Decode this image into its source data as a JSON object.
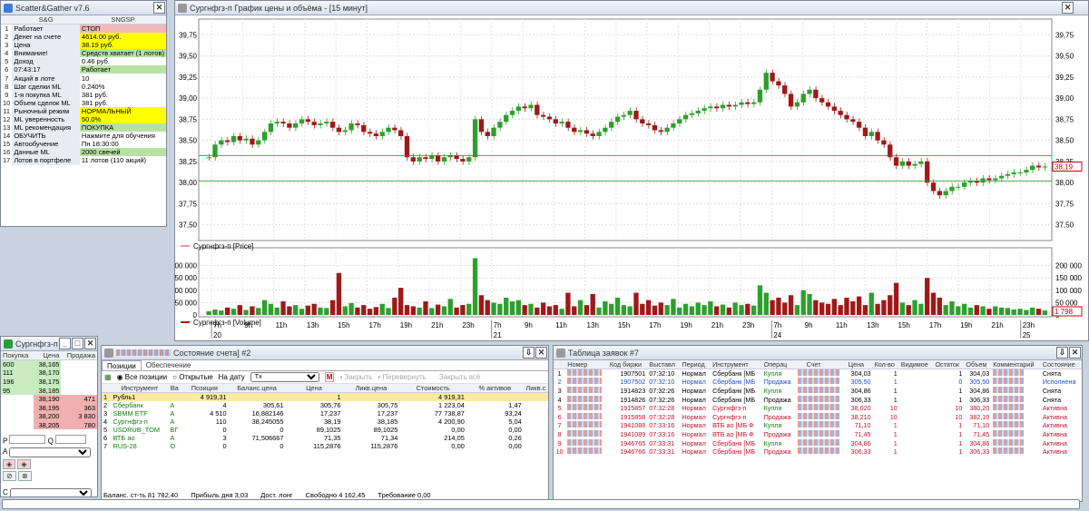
{
  "sg": {
    "title": "Scatter&Gather v7.6",
    "col1": "S&G",
    "col2": "SNGSP",
    "rows": [
      [
        "1",
        "Работает",
        "СТОП",
        "pk"
      ],
      [
        "2",
        "Денег на счете",
        "4614.00 руб.",
        "y"
      ],
      [
        "3",
        "Цена",
        "38.19 руб.",
        "y"
      ],
      [
        "4",
        "Внимание!",
        "Средств хватает (1 лотов)",
        "g"
      ],
      [
        "5",
        "Доход",
        "0.46 руб.",
        ""
      ],
      [
        "6",
        "07:43:17",
        "Работает",
        "g"
      ],
      [
        "7",
        "Акций в лоте",
        "10",
        ""
      ],
      [
        "8",
        "Шаг сделки ML",
        "0.240%",
        ""
      ],
      [
        "9",
        "1-я покупка ML",
        "381 руб.",
        ""
      ],
      [
        "10",
        "Объем сделок ML",
        "381 руб.",
        ""
      ],
      [
        "11",
        "Рыночный режим",
        "НОРМАЛЬНЫЙ",
        "y"
      ],
      [
        "12",
        "ML уверенность",
        "50.0%",
        "y"
      ],
      [
        "13",
        "ML рекомендация",
        "ПОКУПКА",
        "g"
      ],
      [
        "14",
        "ОБУЧИТЬ",
        "Нажмите для обучения",
        ""
      ],
      [
        "15",
        "Автообучение",
        "Пн 18:30:00",
        ""
      ],
      [
        "16",
        "Данные ML",
        "2000 свечей",
        "g"
      ],
      [
        "17",
        "Лотов в портфеле",
        "11 лотов (110 акций)",
        ""
      ]
    ]
  },
  "chart": {
    "title": "Сургнфгз-п График цены и объёма - [15 минут]",
    "price_legend": "Сургнфгз-п [Price]",
    "volume_legend": "Сургнфгз-п [Volume]",
    "price_tag": "38,19",
    "volume_tag": "1 798",
    "price_ticks": [
      "39,75",
      "39,50",
      "39,25",
      "39,00",
      "38,75",
      "38,50",
      "38,25",
      "38,00",
      "37,75",
      "37,50"
    ],
    "volume_ticks": [
      "200 000",
      "150 000",
      "100 000",
      "50 000",
      "0"
    ],
    "time_labels": [
      "7h",
      "9h",
      "11h",
      "13h",
      "15h",
      "17h",
      "19h",
      "21h",
      "23h",
      "7h",
      "9h",
      "11h",
      "13h",
      "15h",
      "17h",
      "19h",
      "21h",
      "23h",
      "7h",
      "9h",
      "11h",
      "13h",
      "15h",
      "17h",
      "19h",
      "21h",
      "23h"
    ],
    "date_labels": [
      "20",
      "21",
      "24",
      "25"
    ]
  },
  "chart_data": {
    "type": "candlestick",
    "title": "Сургнфгз-п График цены и объёма - [15 минут]",
    "ylim": [
      37.4,
      39.85
    ],
    "volume_ylim": [
      0,
      250000
    ],
    "grid": true,
    "close": [
      38.3,
      38.45,
      38.5,
      38.48,
      38.55,
      38.5,
      38.52,
      38.45,
      38.5,
      38.6,
      38.7,
      38.72,
      38.7,
      38.65,
      38.7,
      38.75,
      38.72,
      38.68,
      38.7,
      38.72,
      38.65,
      38.6,
      38.62,
      38.7,
      38.68,
      38.6,
      38.58,
      38.55,
      38.6,
      38.65,
      38.62,
      38.55,
      38.3,
      38.25,
      38.3,
      38.28,
      38.32,
      38.25,
      38.3,
      38.32,
      38.28,
      38.25,
      38.3,
      38.75,
      38.6,
      38.55,
      38.65,
      38.72,
      38.8,
      38.85,
      38.9,
      38.88,
      38.92,
      38.8,
      38.78,
      38.75,
      38.7,
      38.72,
      38.65,
      38.6,
      38.62,
      38.58,
      38.55,
      38.6,
      38.65,
      38.72,
      38.78,
      38.8,
      38.85,
      38.75,
      38.7,
      38.68,
      38.62,
      38.6,
      38.65,
      38.7,
      38.75,
      38.8,
      38.82,
      38.85,
      38.88,
      38.9,
      38.88,
      38.92,
      38.9,
      38.92,
      38.95,
      38.93,
      38.95,
      39.1,
      39.3,
      39.2,
      39.15,
      39.05,
      38.9,
      38.95,
      39.05,
      39.1,
      39.0,
      38.95,
      38.9,
      38.85,
      38.8,
      38.75,
      38.72,
      38.65,
      38.55,
      38.6,
      38.5,
      38.45,
      38.3,
      38.2,
      38.25,
      38.2,
      38.22,
      38.25,
      38.0,
      37.9,
      37.85,
      37.9,
      37.95,
      37.95,
      38.0,
      38.02,
      38.0,
      38.05,
      38.03,
      38.05,
      38.08,
      38.1,
      38.12,
      38.12,
      38.15,
      38.2,
      38.18,
      38.19
    ],
    "volume": [
      15000,
      22000,
      18000,
      30000,
      25000,
      40000,
      20000,
      35000,
      28000,
      60000,
      45000,
      30000,
      55000,
      35000,
      40000,
      25000,
      38000,
      45000,
      30000,
      28000,
      60000,
      170000,
      35000,
      48000,
      30000,
      40000,
      25000,
      32000,
      45000,
      28000,
      70000,
      110000,
      40000,
      35000,
      30000,
      55000,
      28000,
      42000,
      35000,
      65000,
      30000,
      40000,
      45000,
      230000,
      80000,
      60000,
      50000,
      45000,
      70000,
      55000,
      60000,
      40000,
      45000,
      30000,
      50000,
      35000,
      40000,
      25000,
      90000,
      35000,
      60000,
      40000,
      85000,
      30000,
      55000,
      45000,
      70000,
      40000,
      35000,
      90000,
      45000,
      60000,
      38000,
      50000,
      40000,
      65000,
      30000,
      45000,
      35000,
      50000,
      40000,
      55000,
      35000,
      42000,
      30000,
      50000,
      40000,
      45000,
      38000,
      120000,
      90000,
      60000,
      70000,
      50000,
      80000,
      40000,
      100000,
      85000,
      60000,
      50000,
      45000,
      65000,
      40000,
      70000,
      55000,
      75000,
      40000,
      90000,
      45000,
      60000,
      80000,
      130000,
      50000,
      40000,
      60000,
      45000,
      150000,
      90000,
      70000,
      40000,
      55000,
      35000,
      45000,
      30000,
      40000,
      35000,
      25000,
      35000,
      30000,
      28000,
      22000,
      25000,
      20000,
      30000,
      25000,
      18000
    ]
  },
  "orderbook": {
    "title": "Сургнфгз-п [МБ",
    "headers": [
      "Покупка",
      "Цена",
      "Продажа"
    ],
    "rows": [
      [
        "600",
        "38,165",
        ""
      ],
      [
        "111",
        "38,170",
        ""
      ],
      [
        "196",
        "38,175",
        ""
      ],
      [
        "95",
        "38,185",
        ""
      ],
      [
        "",
        "38,190",
        "471"
      ],
      [
        "",
        "38,195",
        "363"
      ],
      [
        "",
        "38,200",
        "3 830"
      ],
      [
        "",
        "38,205",
        "780"
      ]
    ]
  },
  "state": {
    "title": "Состояние счета] #2",
    "tabs": [
      "Позиции",
      "Обеспечение"
    ],
    "all": "Все позиции",
    "open": "Открытые",
    "ondate": "На дату",
    "tx": "Tx",
    "close": "Закрыть",
    "flip": "Перевернуть",
    "closeall": "Закрыть всё",
    "headers": [
      "",
      "Инструмент",
      "Ва",
      "Позиция",
      "Баланс.цена",
      "Цена",
      "Ликв.цена",
      "Стоимость",
      "% активов",
      "Ликв.с"
    ],
    "rows": [
      [
        "1",
        "Рубль1",
        "",
        "4 919,31",
        "",
        "1",
        "",
        "4 919,31",
        "",
        ""
      ],
      [
        "2",
        "Сбербанк",
        "А",
        "4",
        "305,61",
        "305,76",
        "305,75",
        "1 223,04",
        "1,47",
        ""
      ],
      [
        "3",
        "SBMM ETF",
        "А",
        "4 510",
        "16,882146",
        "17,237",
        "17,237",
        "77 738,87",
        "93,24",
        ""
      ],
      [
        "4",
        "Сургнфгз-п",
        "А",
        "110",
        "38,245055",
        "38,19",
        "38,185",
        "4 200,90",
        "5,04",
        ""
      ],
      [
        "5",
        "USDRUB_TOM",
        "ВГ",
        "0",
        "0",
        "89,1025",
        "89,1025",
        "0,00",
        "0,00",
        ""
      ],
      [
        "6",
        "ВТБ ао",
        "А",
        "3",
        "71,506667",
        "71,35",
        "71,34",
        "214,05",
        "0,26",
        ""
      ],
      [
        "7",
        "RUS-28",
        "О",
        "0",
        "0",
        "115,2876",
        "115,2876",
        "0,00",
        "0,00",
        ""
      ]
    ],
    "footer": {
      "balance": "Баланс. ст-ть  81 782,40",
      "profit": "Прибыль дня   3,03",
      "long": "Дост. лонг",
      "free": "Свободно   4 162,45",
      "req": "Требование   0,00"
    }
  },
  "orders": {
    "title": "Таблица заявок #7",
    "headers": [
      "",
      "Номер",
      "Код биржи",
      "Выставл",
      "Период",
      "Инструмент",
      "Операц",
      "",
      "Счет",
      "Цена",
      "Кол-во",
      "Видимое",
      "Остаток",
      "Объем",
      "Комментарий",
      "Состояние"
    ],
    "rows": [
      [
        "1",
        "1907501",
        "07:32:10",
        "Нормал",
        "Сбербанк [МБ",
        "Купля",
        "304,03",
        "1",
        "1",
        "304,03",
        "Снята",
        "blk"
      ],
      [
        "2",
        "1907502",
        "07:32:10",
        "Нормал",
        "Сбербанк [МБ",
        "Продажа",
        "305,50",
        "1",
        "0",
        "305,50",
        "Исполнена",
        "blu"
      ],
      [
        "3",
        "1914823",
        "07:32:26",
        "Нормал",
        "Сбербанк [МБ",
        "Купля",
        "304,86",
        "1",
        "1",
        "304,86",
        "Снята",
        "blk"
      ],
      [
        "4",
        "1914826",
        "07:32:26",
        "Нормал",
        "Сбербанк [МБ",
        "Продажа",
        "306,33",
        "1",
        "1",
        "306,33",
        "Снята",
        "blk"
      ],
      [
        "5",
        "1915857",
        "07:32:28",
        "Нормал",
        "Сургнфгз-п",
        "Купля",
        "38,020",
        "10",
        "10",
        "380,20",
        "Активна",
        "red"
      ],
      [
        "6",
        "1915858",
        "07:32:28",
        "Нормал",
        "Сургнфгз-п",
        "Продажа",
        "38,210",
        "10",
        "10",
        "382,10",
        "Активна",
        "red"
      ],
      [
        "7",
        "1941088",
        "07:33:16",
        "Нормал",
        "ВТБ ао [МБ Ф",
        "Купля",
        "71,10",
        "1",
        "1",
        "71,10",
        "Активна",
        "red"
      ],
      [
        "8",
        "1941089",
        "07:33:16",
        "Нормал",
        "ВТБ ао [МБ Ф",
        "Продажа",
        "71,45",
        "1",
        "1",
        "71,45",
        "Активна",
        "red"
      ],
      [
        "9",
        "1946765",
        "07:33:31",
        "Нормал",
        "Сбербанк [МБ",
        "Купля",
        "304,86",
        "1",
        "1",
        "304,86",
        "Активна",
        "red"
      ],
      [
        "10",
        "1946766",
        "07:33:31",
        "Нормал",
        "Сбербанк [МБ",
        "Продажа",
        "306,33",
        "1",
        "1",
        "306,33",
        "Активна",
        "red"
      ]
    ]
  }
}
